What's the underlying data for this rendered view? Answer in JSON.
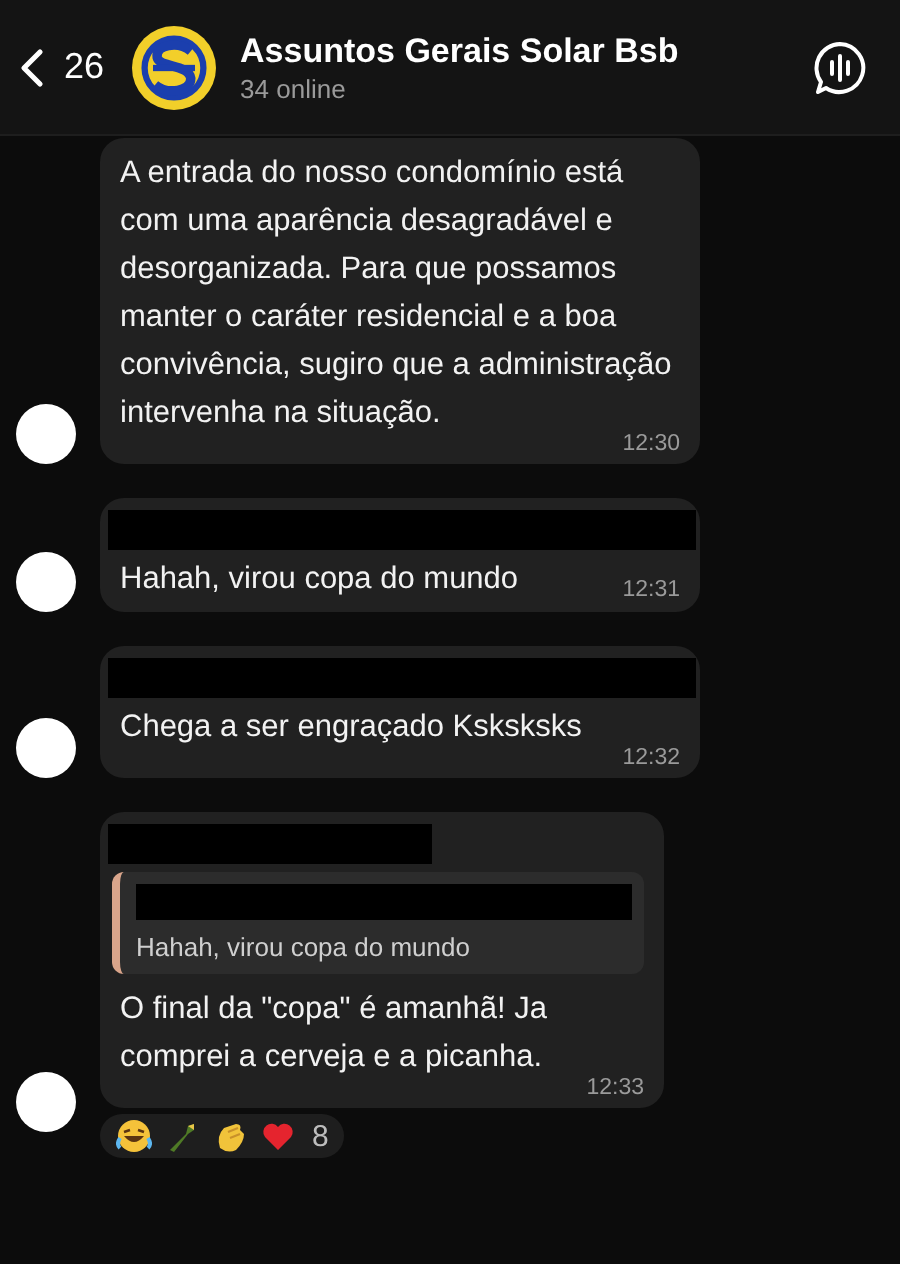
{
  "header": {
    "back_count": "26",
    "title": "Assuntos Gerais Solar Bsb",
    "subtitle": "34 online"
  },
  "messages": [
    {
      "sender_redacted": false,
      "text": "A entrada do nosso condomínio está com uma aparência desagradável e desorganizada. Para que possamos manter o caráter residencial e a boa convivência, sugiro que a administração intervenha na situação.",
      "time": "12:30",
      "inline_time": false
    },
    {
      "sender_redacted": true,
      "text": "Hahah, virou copa do mundo",
      "time": "12:31",
      "inline_time": true
    },
    {
      "sender_redacted": true,
      "text": "Chega a ser engraçado Ksksksks",
      "time": "12:32",
      "inline_time": false
    },
    {
      "sender_redacted": true,
      "reply": {
        "sender_redacted": true,
        "text": "Hahah, virou copa do mundo"
      },
      "text": "O final da \"copa\" é amanhã! Ja comprei a cerveja e a picanha.",
      "time": "12:33",
      "inline_time": false,
      "reactions": [
        {
          "kind": "laugh"
        },
        {
          "kind": "bottle"
        },
        {
          "kind": "clap"
        },
        {
          "kind": "heart"
        }
      ],
      "reaction_count": "8"
    }
  ]
}
